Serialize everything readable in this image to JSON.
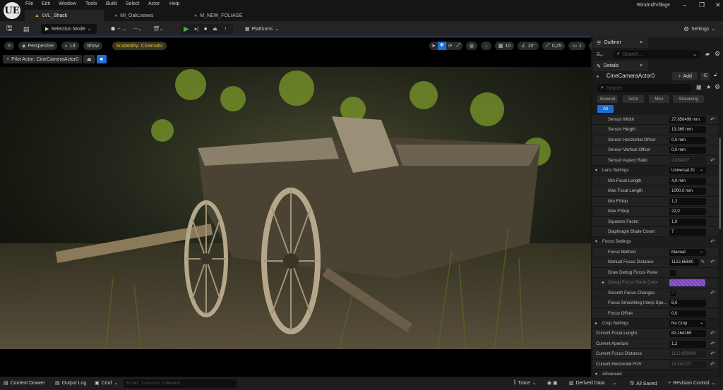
{
  "app": {
    "project": "WindmillVillage",
    "logo": "UE"
  },
  "menu": [
    "File",
    "Edit",
    "Window",
    "Tools",
    "Build",
    "Select",
    "Actor",
    "Help"
  ],
  "tabs": [
    {
      "label": "LVL_Shack",
      "icon": "level-icon",
      "color": "#e0a020"
    },
    {
      "label": "MI_OakLeaves",
      "icon": "material-instance-icon",
      "color": "#2a9a3a"
    },
    {
      "label": "M_NEW_FOLIAGE",
      "icon": "material-icon",
      "color": "#2a9a3a"
    }
  ],
  "toolbar": {
    "selection_mode": "Selection Mode",
    "platforms": "Platforms",
    "settings": "Settings"
  },
  "viewport": {
    "perspective": "Perspective",
    "lit": "Lit",
    "show": "Show",
    "scalability": "Scalability: Cinematic",
    "pilot": "Pilot Actor: CineCameraActor0",
    "grid": "10",
    "angle": "10°",
    "scale": "0,25",
    "camera_speed": "1"
  },
  "outliner": {
    "tab": "Outliner",
    "search_placeholder": "Search..."
  },
  "details": {
    "tab": "Details",
    "actor": "CineCameraActor0",
    "add": "Add",
    "search_placeholder": "Search",
    "filters": [
      "General",
      "Actor",
      "Misc",
      "Streaming"
    ],
    "all": "All",
    "rows": [
      {
        "label": "Sensor Width",
        "value": "27,856499 mm",
        "type": "input",
        "indent": 2,
        "reset": true
      },
      {
        "label": "Sensor Height",
        "value": "13,365 mm",
        "type": "input",
        "indent": 2
      },
      {
        "label": "Sensor Horizontal Offset",
        "value": "0,0 mm",
        "type": "input",
        "indent": 2
      },
      {
        "label": "Sensor Vertical Offset",
        "value": "0,0 mm",
        "type": "input",
        "indent": 2
      },
      {
        "label": "Sensor Aspect Ratio",
        "value": "2,084287",
        "type": "readonly",
        "indent": 2,
        "reset": true
      },
      {
        "label": "Lens Settings",
        "value": "Universal Zc",
        "type": "dropdown",
        "indent": 1,
        "cat": true
      },
      {
        "label": "Min Focal Length",
        "value": "4,0 mm",
        "type": "input",
        "indent": 2
      },
      {
        "label": "Max Focal Length",
        "value": "1000,0 mm",
        "type": "input",
        "indent": 2
      },
      {
        "label": "Min FStop",
        "value": "1,2",
        "type": "input",
        "indent": 2
      },
      {
        "label": "Max FStop",
        "value": "22,0",
        "type": "input",
        "indent": 2
      },
      {
        "label": "Squeeze Factor",
        "value": "1,0",
        "type": "input",
        "indent": 2
      },
      {
        "label": "Diaphragm Blade Count",
        "value": "7",
        "type": "input",
        "indent": 2
      },
      {
        "label": "Focus Settings",
        "value": "",
        "type": "none",
        "indent": 1,
        "cat": true,
        "reset": true
      },
      {
        "label": "Focus Method",
        "value": "Manual",
        "type": "dropdown",
        "indent": 2
      },
      {
        "label": "Manual Focus Distance",
        "value": "1122,65600",
        "type": "input",
        "indent": 2,
        "reset": true,
        "picker": true
      },
      {
        "label": "Draw Debug Focus Plane",
        "value": "",
        "type": "checkbox",
        "indent": 2
      },
      {
        "label": "Debug Focus Plane Color",
        "value": "",
        "type": "color",
        "indent": 2,
        "dim": true,
        "color": "#7a3fc0"
      },
      {
        "label": "Smooth Focus Changes",
        "value": "",
        "type": "checked",
        "indent": 2,
        "reset": true
      },
      {
        "label": "Focus Smoothing Interp Spe...",
        "value": "8,0",
        "type": "input",
        "indent": 2
      },
      {
        "label": "Focus Offset",
        "value": "0,0",
        "type": "input",
        "indent": 2
      },
      {
        "label": "Crop Settings",
        "value": "No Crop",
        "type": "dropdown",
        "indent": 1,
        "cat": true,
        "collapsed": true
      },
      {
        "label": "Current Focal Length",
        "value": "82,164169",
        "type": "input",
        "indent": 1,
        "reset": true
      },
      {
        "label": "Current Aperture",
        "value": "1,2",
        "type": "input",
        "indent": 1,
        "reset": true
      },
      {
        "label": "Current Focus Distance",
        "value": "1122,656006",
        "type": "readonly",
        "indent": 1,
        "reset": true
      },
      {
        "label": "Current Horizontal FOV",
        "value": "19,242327",
        "type": "readonly",
        "indent": 1,
        "reset": true
      },
      {
        "label": "Advanced",
        "value": "",
        "type": "none",
        "indent": 1,
        "cat": true
      }
    ]
  },
  "bottom": {
    "content_drawer": "Content Drawer",
    "output_log": "Output Log",
    "cmd": "Cmd",
    "console_placeholder": "Enter Console Command",
    "trace": "Trace",
    "derived_data": "Derived Data",
    "all_saved": "All Saved",
    "revision_control": "Revision Control"
  }
}
